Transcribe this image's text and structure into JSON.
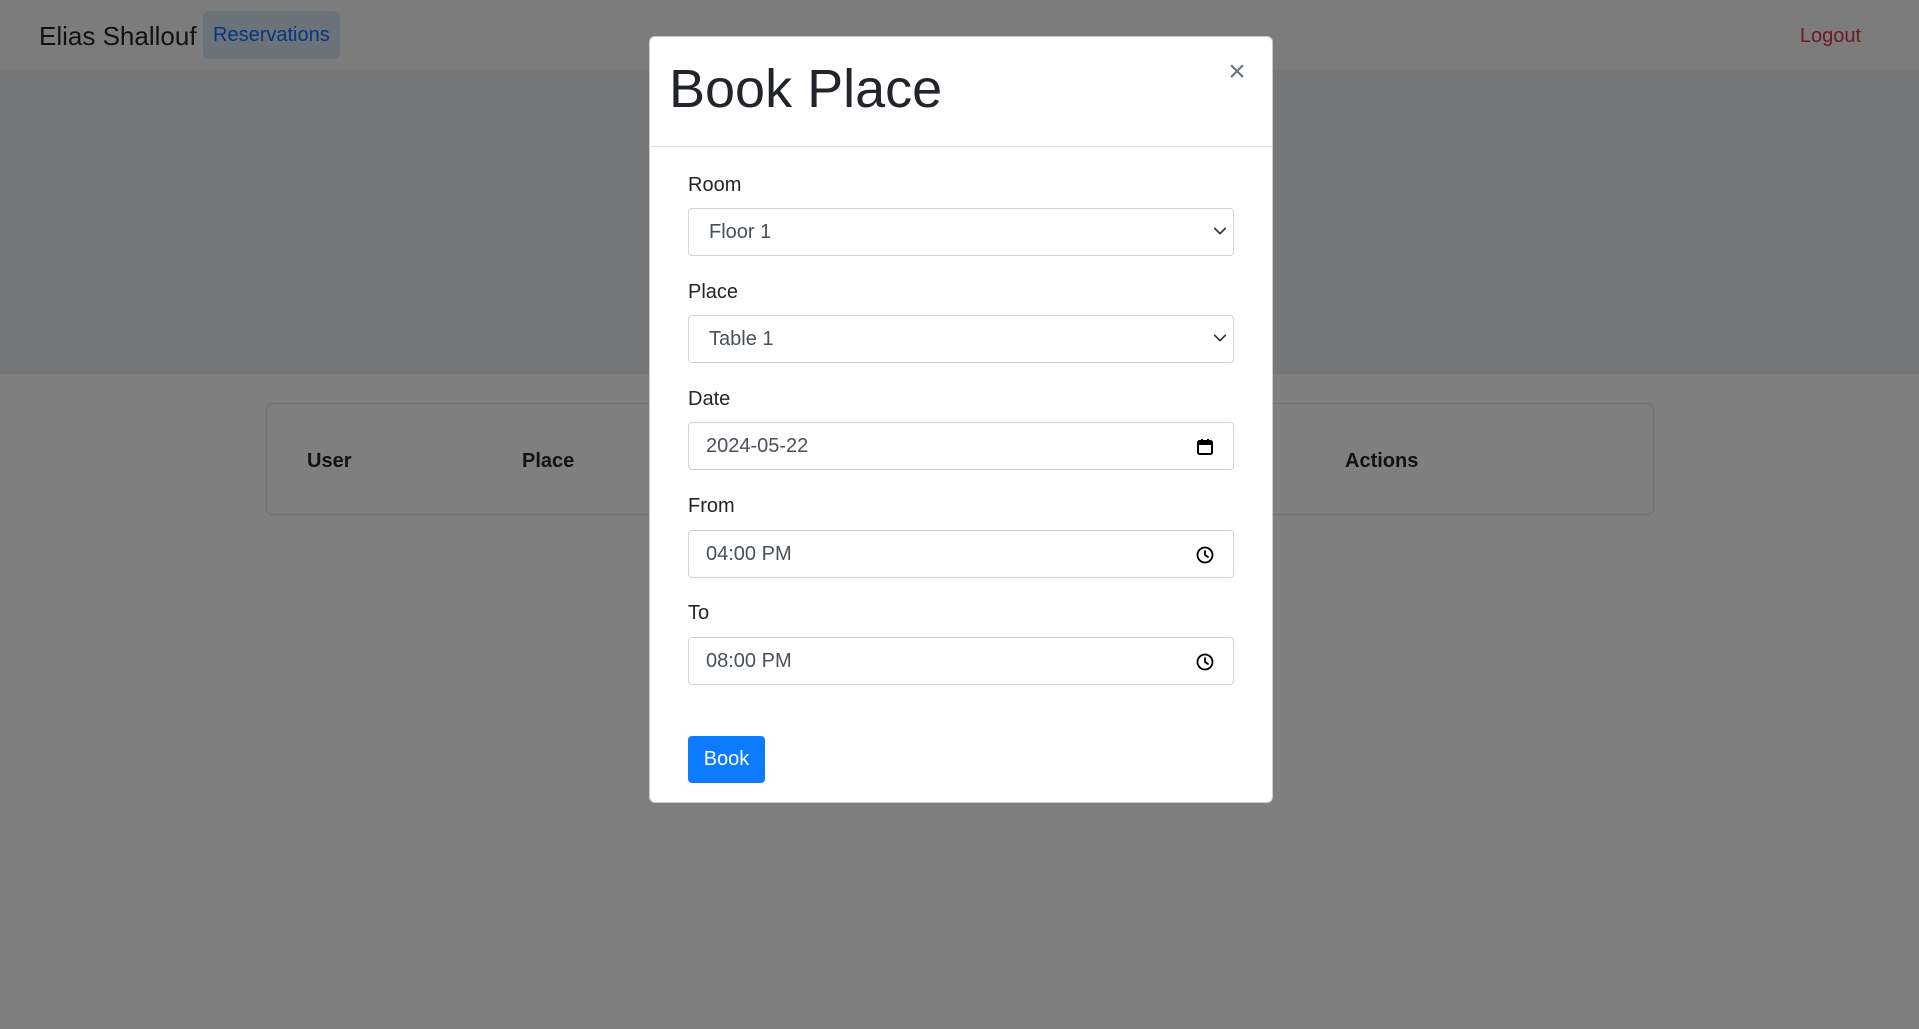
{
  "navbar": {
    "brand": "Elias Shallouf",
    "active_item": "Reservations",
    "logout": "Logout"
  },
  "table": {
    "headers": {
      "user": "User",
      "place": "Place",
      "actions": "Actions"
    }
  },
  "modal": {
    "title": "Book Place",
    "close_symbol": "×",
    "fields": {
      "room": {
        "label": "Room",
        "value": "Floor 1"
      },
      "place": {
        "label": "Place",
        "value": "Table 1"
      },
      "date": {
        "label": "Date",
        "value": "2024-05-22"
      },
      "from": {
        "label": "From",
        "value": "04:00 PM"
      },
      "to": {
        "label": "To",
        "value": "08:00 PM"
      }
    },
    "submit_label": "Book"
  },
  "colors": {
    "primary": "#0d7bff",
    "danger": "#dc3545",
    "backdrop": "rgba(0,0,0,0.5)"
  },
  "icons": {
    "close": "close-icon",
    "select_arrow": "chevron-down-icon",
    "date": "calendar-icon",
    "time": "clock-icon"
  }
}
